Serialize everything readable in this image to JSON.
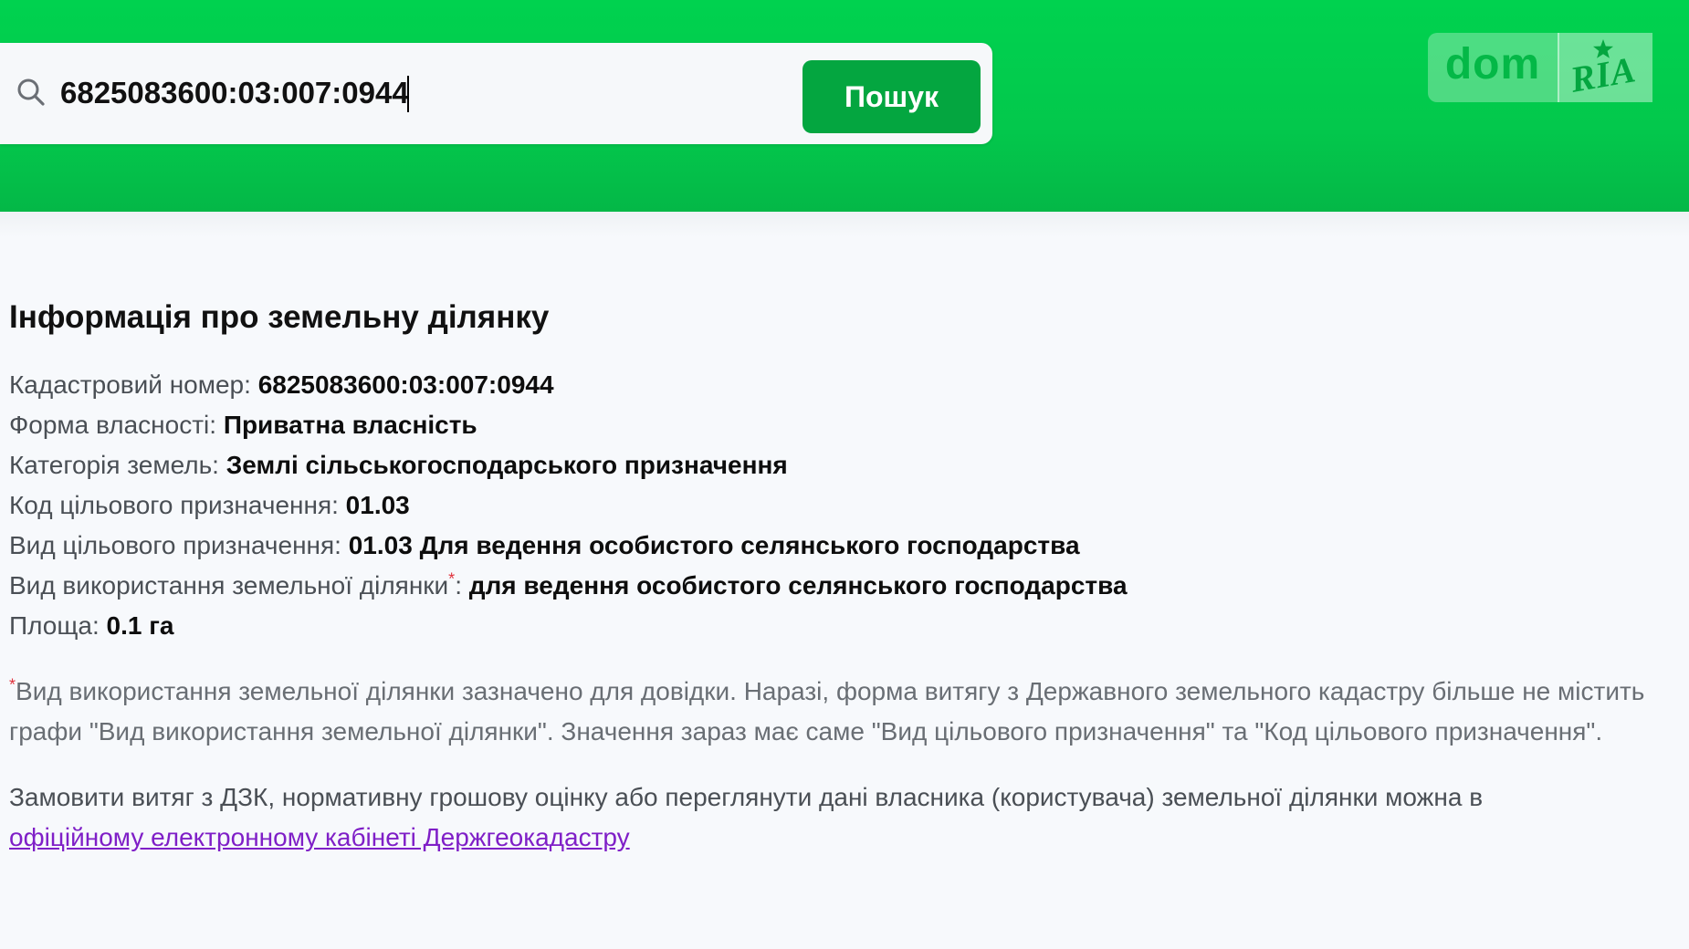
{
  "header": {
    "search": {
      "value": "6825083600:03:007:0944",
      "button_label": "Пошук"
    },
    "logo": {
      "part1": "dom",
      "part2": "RIA"
    }
  },
  "main": {
    "title": "Інформація про земельну ділянку",
    "rows": [
      {
        "label": "Кадастровий номер:",
        "value": "6825083600:03:007:0944"
      },
      {
        "label": "Форма власності:",
        "value": "Приватна власність"
      },
      {
        "label": "Категорія земель:",
        "value": "Землі сільськогосподарського призначення"
      },
      {
        "label": "Код цільового призначення:",
        "value": "01.03"
      },
      {
        "label": "Вид цільового призначення:",
        "value": "01.03 Для ведення особистого селянського господарства"
      },
      {
        "label": "Вид використання земельної ділянки",
        "asterisk": "*",
        "colon": ":",
        "value": "для ведення особистого селянського господарства"
      },
      {
        "label": "Площа:",
        "value": "0.1 га"
      }
    ],
    "note": {
      "asterisk": "*",
      "text": "Вид використання земельної ділянки зазначено для довідки. Наразі, форма витягу з Державного земельного кадастру більше не містить графи \"Вид використання земельної ділянки\". Значення зараз має саме \"Вид цільового призначення\" та \"Код цільового призначення\"."
    },
    "cta": {
      "text": "Замовити витяг з ДЗК, нормативну грошову оцінку або переглянути дані власника (користувача) земельної ділянки можна в",
      "link_text": "офіційному електронному кабінеті Держгеокадастру"
    }
  },
  "colors": {
    "header_green": "#00d24f",
    "button_green": "#04a640",
    "link_purple": "#7f1fc7",
    "asterisk_red": "#e0323c"
  }
}
